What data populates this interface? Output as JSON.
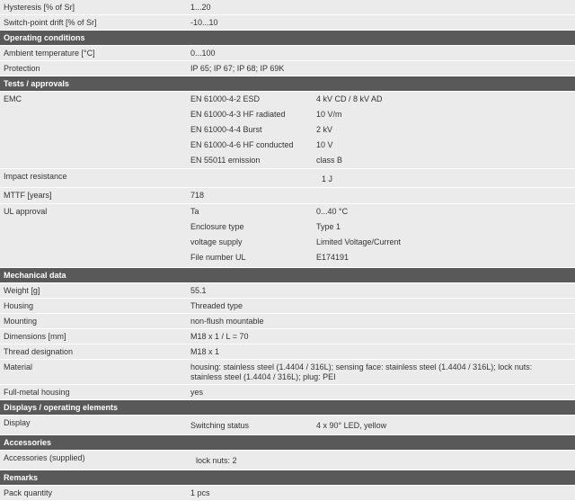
{
  "top": [
    {
      "label": "Hysteresis [% of Sr]",
      "value": "1...20"
    },
    {
      "label": "Switch-point drift [% of Sr]",
      "value": "-10...10"
    }
  ],
  "operating": {
    "title": "Operating conditions",
    "rows": [
      {
        "label": "Ambient temperature [°C]",
        "value": "0...100"
      },
      {
        "label": "Protection",
        "value": "IP 65; IP 67; IP 68; IP 69K"
      }
    ]
  },
  "tests": {
    "title": "Tests / approvals",
    "emc": {
      "label": "EMC",
      "items": [
        {
          "k": "EN 61000-4-2 ESD",
          "v": "4 kV CD / 8 kV AD"
        },
        {
          "k": "EN 61000-4-3 HF radiated",
          "v": "10 V/m"
        },
        {
          "k": "EN 61000-4-4 Burst",
          "v": "2 kV"
        },
        {
          "k": "EN 61000-4-6 HF conducted",
          "v": "10 V"
        },
        {
          "k": "EN 55011 emission",
          "v": "class B"
        }
      ]
    },
    "impact": {
      "label": "Impact resistance",
      "value": "1 J"
    },
    "mttf": {
      "label": "MTTF [years]",
      "value": "718"
    },
    "ul": {
      "label": "UL approval",
      "items": [
        {
          "k": "Ta",
          "v": "0...40 °C"
        },
        {
          "k": "Enclosure type",
          "v": "Type 1"
        },
        {
          "k": "voltage supply",
          "v": "Limited Voltage/Current"
        },
        {
          "k": "File number UL",
          "v": "E174191"
        }
      ]
    }
  },
  "mechanical": {
    "title": "Mechanical data",
    "rows": [
      {
        "label": "Weight [g]",
        "value": "55.1"
      },
      {
        "label": "Housing",
        "value": "Threaded type"
      },
      {
        "label": "Mounting",
        "value": "non-flush mountable"
      },
      {
        "label": "Dimensions [mm]",
        "value": "M18 x 1 / L = 70"
      },
      {
        "label": "Thread designation",
        "value": "M18 x 1"
      },
      {
        "label": "Material",
        "value": "housing: stainless steel (1.4404 / 316L); sensing face: stainless steel (1.4404 / 316L); lock nuts: stainless steel (1.4404 / 316L); plug: PEI"
      },
      {
        "label": "Full-metal housing",
        "value": "yes"
      }
    ]
  },
  "displays": {
    "title": "Displays / operating elements",
    "display": {
      "label": "Display",
      "k": "Switching status",
      "v": "4 x 90° LED, yellow"
    }
  },
  "accessories": {
    "title": "Accessories",
    "supplied": {
      "label": "Accessories (supplied)",
      "value": "lock nuts: 2"
    }
  },
  "remarks": {
    "title": "Remarks",
    "pack": {
      "label": "Pack quantity",
      "value": "1 pcs"
    }
  }
}
